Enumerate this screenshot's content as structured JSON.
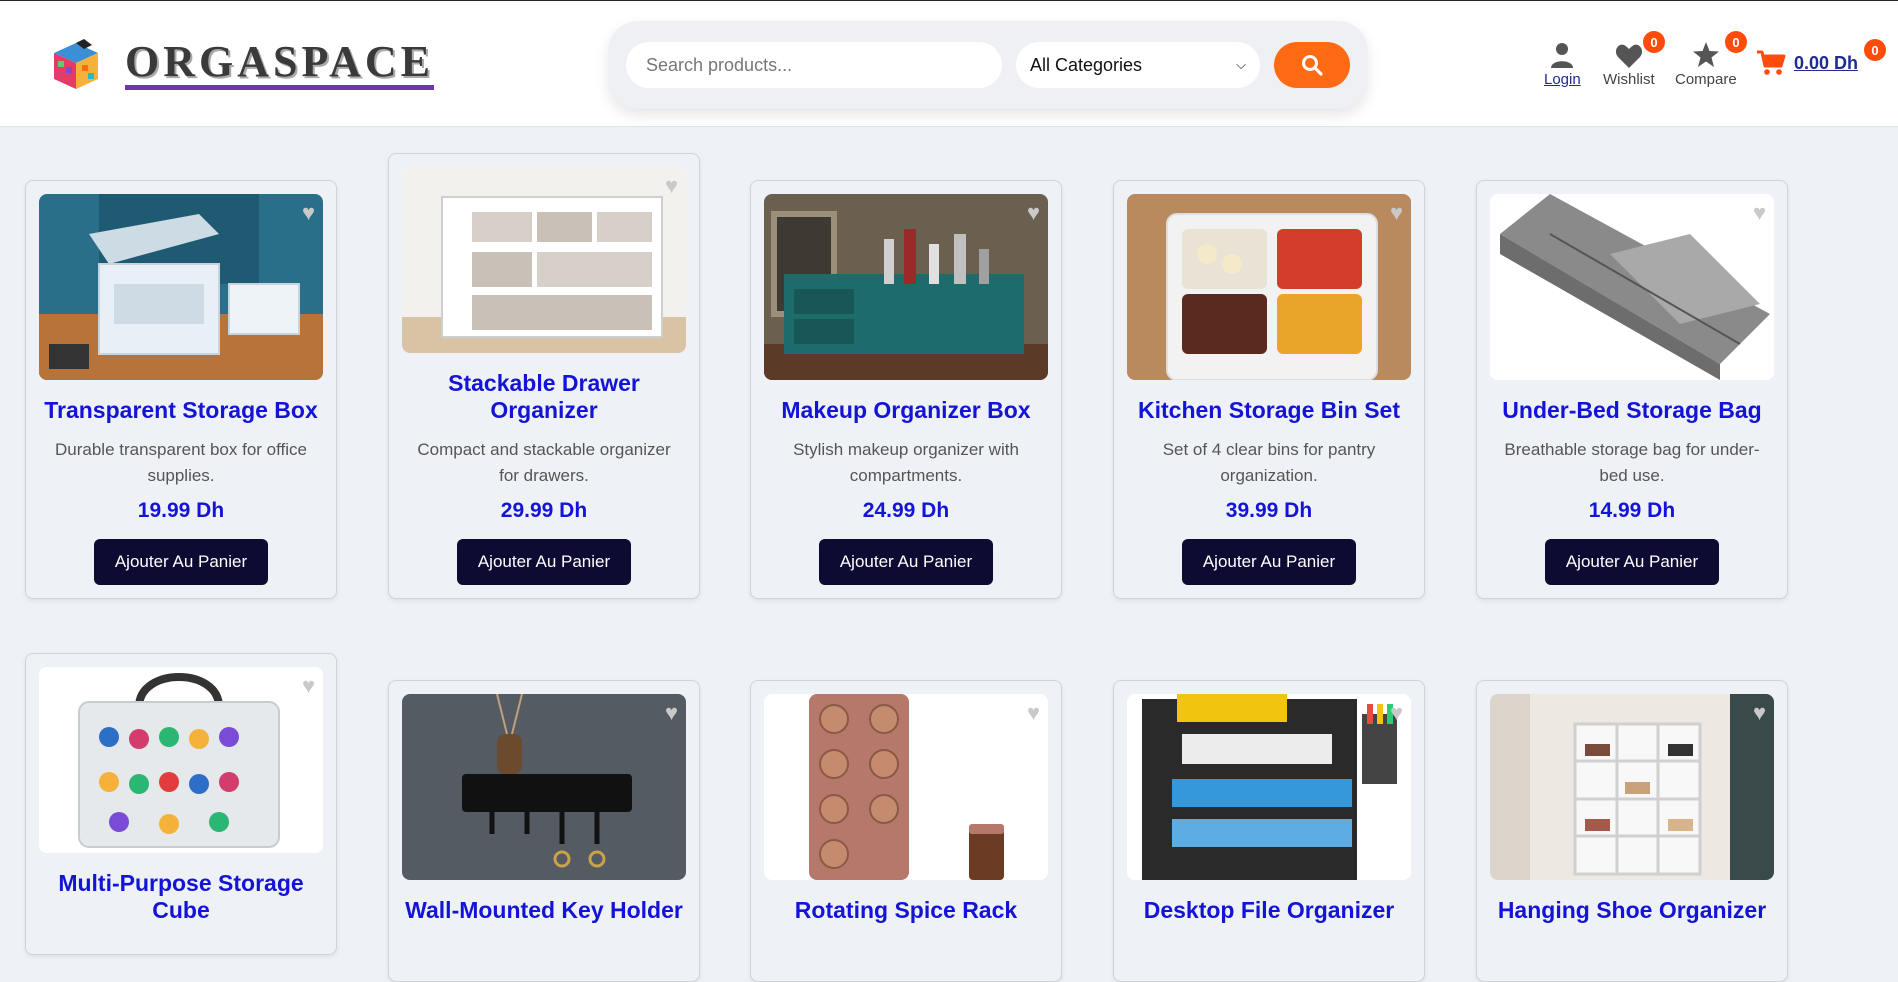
{
  "brand": {
    "name": "ORGASPACE"
  },
  "search": {
    "placeholder": "Search products...",
    "category_selected": "All Categories"
  },
  "nav": {
    "login": "Login",
    "wishlist": {
      "label": "Wishlist",
      "count": "0"
    },
    "compare": {
      "label": "Compare",
      "count": "0"
    },
    "cart": {
      "total": "0.00 Dh",
      "count": "0"
    }
  },
  "colors": {
    "accent": "#ff6a13",
    "title": "#1414d6",
    "button": "#0e0b33",
    "badge": "#ff4c0a"
  },
  "products": [
    {
      "title": "Transparent Storage Box",
      "desc": "Durable transparent box for office supplies.",
      "price": "19.99 Dh",
      "button": "Ajouter Au Panier"
    },
    {
      "title": "Stackable Drawer Organizer",
      "desc": "Compact and stackable organizer for drawers.",
      "price": "29.99 Dh",
      "button": "Ajouter Au Panier"
    },
    {
      "title": "Makeup Organizer Box",
      "desc": "Stylish makeup organizer with compartments.",
      "price": "24.99 Dh",
      "button": "Ajouter Au Panier"
    },
    {
      "title": "Kitchen Storage Bin Set",
      "desc": "Set of 4 clear bins for pantry organization.",
      "price": "39.99 Dh",
      "button": "Ajouter Au Panier"
    },
    {
      "title": "Under-Bed Storage Bag",
      "desc": "Breathable storage bag for under-bed use.",
      "price": "14.99 Dh",
      "button": "Ajouter Au Panier"
    },
    {
      "title": "Multi-Purpose Storage Cube"
    },
    {
      "title": "Wall-Mounted Key Holder"
    },
    {
      "title": "Rotating Spice Rack"
    },
    {
      "title": "Desktop File Organizer"
    },
    {
      "title": "Hanging Shoe Organizer"
    }
  ]
}
